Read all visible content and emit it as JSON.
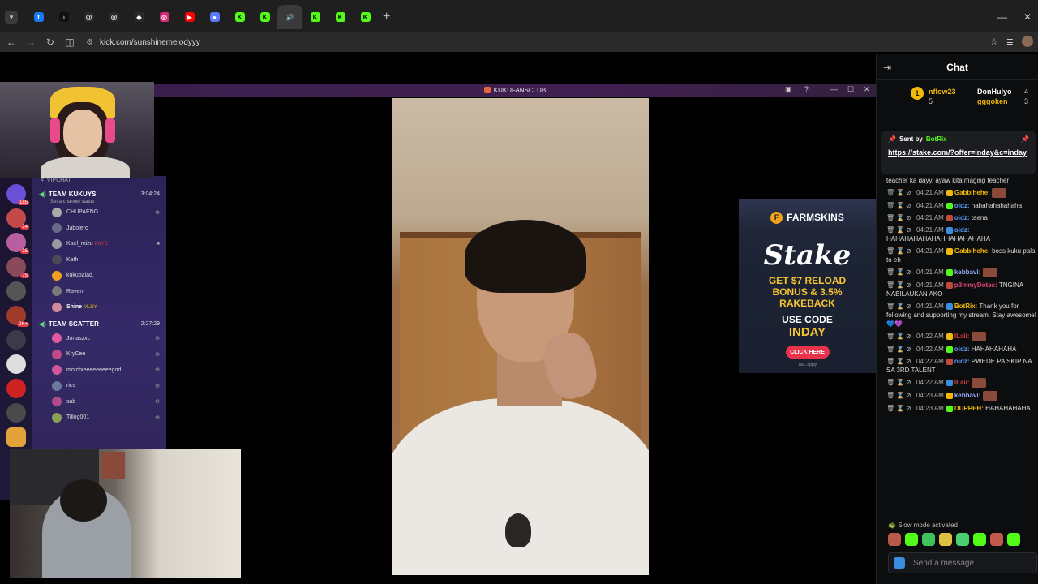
{
  "browser": {
    "url": "kick.com/sunshinemelodyyy",
    "tabs": [
      {
        "icon": "facebook-icon",
        "color": "#1877f2",
        "glyph": "f"
      },
      {
        "icon": "tiktok-icon",
        "color": "#111111",
        "glyph": "♪"
      },
      {
        "icon": "threads-icon",
        "color": "#2a2a2a",
        "glyph": "@"
      },
      {
        "icon": "threads-icon",
        "color": "#2a2a2a",
        "glyph": "@"
      },
      {
        "icon": "diamond-icon",
        "color": "#2a2a2a",
        "glyph": "◆"
      },
      {
        "icon": "instagram-icon",
        "color": "#d62976",
        "glyph": "◎"
      },
      {
        "icon": "youtube-icon",
        "color": "#ff0000",
        "glyph": "▶"
      },
      {
        "icon": "messenger-icon",
        "color": "#5b7cfa",
        "glyph": "●"
      },
      {
        "icon": "kick-icon",
        "color": "#53fc18",
        "glyph": "K"
      },
      {
        "icon": "kick-icon",
        "color": "#53fc18",
        "glyph": "K"
      },
      {
        "icon": "audio-tab-icon",
        "color": "#3a3a3a",
        "glyph": "🔊",
        "active": true
      },
      {
        "icon": "kick-icon",
        "color": "#53fc18",
        "glyph": "K"
      },
      {
        "icon": "kick-icon",
        "color": "#53fc18",
        "glyph": "K"
      },
      {
        "icon": "kick-icon",
        "color": "#53fc18",
        "glyph": "K"
      }
    ]
  },
  "discord": {
    "window_title": "KUKUFANSCLUB",
    "channel_header": "VIPCHAT",
    "vc1": {
      "name": "TEAM KUKUYS",
      "timer": "3:04:24",
      "status": "Set a channel status",
      "members": [
        "CHUPAENG",
        "Jabolero",
        "Kael_mizu",
        "Kath",
        "kukupalad.",
        "Raven",
        "Shine"
      ]
    },
    "vc2": {
      "name": "TEAM SCATTER",
      "timer": "2:27:29",
      "members": [
        "Jonaszxc",
        "KryCee",
        "motchieeeeeeeeegod",
        "rics",
        "sab",
        "Tillog001"
      ]
    },
    "tags": {
      "kael": "KKYS",
      "shine": "MLDY"
    },
    "server_badges": [
      "185",
      "24",
      "35",
      "75",
      "2K+"
    ]
  },
  "ad": {
    "brand": "FARMSKINS",
    "headline": "Stake",
    "promo_line1": "GET $7 RELOAD",
    "promo_line2": "BONUS & 3.5%",
    "promo_line3": "RAKEBACK",
    "code_label": "USE CODE",
    "code": "INDAY",
    "button": "CLICK HERE",
    "fineprint": "T&C apply"
  },
  "chat": {
    "title": "Chat",
    "leaderboard": [
      {
        "rank": "1",
        "name": "nflow23",
        "count": "5"
      },
      {
        "name": "DonHulyo",
        "count": "4"
      },
      {
        "name": "gggoken",
        "count": "3"
      }
    ],
    "pinned": {
      "sent_by_label": "Sent by",
      "sender": "BotRix",
      "link": "https://stake.com/?offer=inday&c=inday"
    },
    "messages": [
      {
        "time": "",
        "user": "",
        "user_color": "#dddddd",
        "text": "teacher ka dayy, ayaw kita maging teacher",
        "partial": true
      },
      {
        "time": "04:21 AM",
        "user": "Gabbihehe:",
        "user_color": "#f0b90b",
        "text": ""
      },
      {
        "time": "04:21 AM",
        "user": "oidz:",
        "user_color": "#5b9bff",
        "text": "hahahahahahaha"
      },
      {
        "time": "04:21 AM",
        "user": "oidz:",
        "user_color": "#5b9bff",
        "text": "taena"
      },
      {
        "time": "04:21 AM",
        "user": "oidz:",
        "user_color": "#5b9bff",
        "text": "HAHAHAHAHAHAHHAHAHAHAHA",
        "wrap": true
      },
      {
        "time": "04:21 AM",
        "user": "Gabbihehe:",
        "user_color": "#f0b90b",
        "text": "boss kuku pala to eh",
        "wrap": true
      },
      {
        "time": "04:21 AM",
        "user": "kebbavi:",
        "user_color": "#9ab0ff",
        "text": ""
      },
      {
        "time": "04:21 AM",
        "user": "p3mmyDotes:",
        "user_color": "#e0457b",
        "text": "TNGINA NABILAUKAN AKO",
        "wrap": true
      },
      {
        "time": "04:21 AM",
        "user": "BotRix:",
        "user_color": "#f0b90b",
        "text": "Thank you for following and supporting my stream. Stay awesome! 💙💜",
        "wrap": true
      },
      {
        "time": "04:22 AM",
        "user": "ILaii:",
        "user_color": "#e23b3b",
        "text": ""
      },
      {
        "time": "04:22 AM",
        "user": "oidz:",
        "user_color": "#5b9bff",
        "text": "HAHAHAHAHA"
      },
      {
        "time": "04:22 AM",
        "user": "oidz:",
        "user_color": "#5b9bff",
        "text": "PWEDE PA SKIP NA SA 3RD TALENT",
        "wrap": true
      },
      {
        "time": "04:22 AM",
        "user": "ILaii:",
        "user_color": "#e23b3b",
        "text": ""
      },
      {
        "time": "04:23 AM",
        "user": "kebbavi:",
        "user_color": "#9ab0ff",
        "text": ""
      },
      {
        "time": "04:23 AM",
        "user": "DUPPEH:",
        "user_color": "#f0b90b",
        "text": "HAHAHAHAHA"
      }
    ],
    "slow_mode": "Slow mode activated",
    "input_placeholder": "Send a message"
  }
}
